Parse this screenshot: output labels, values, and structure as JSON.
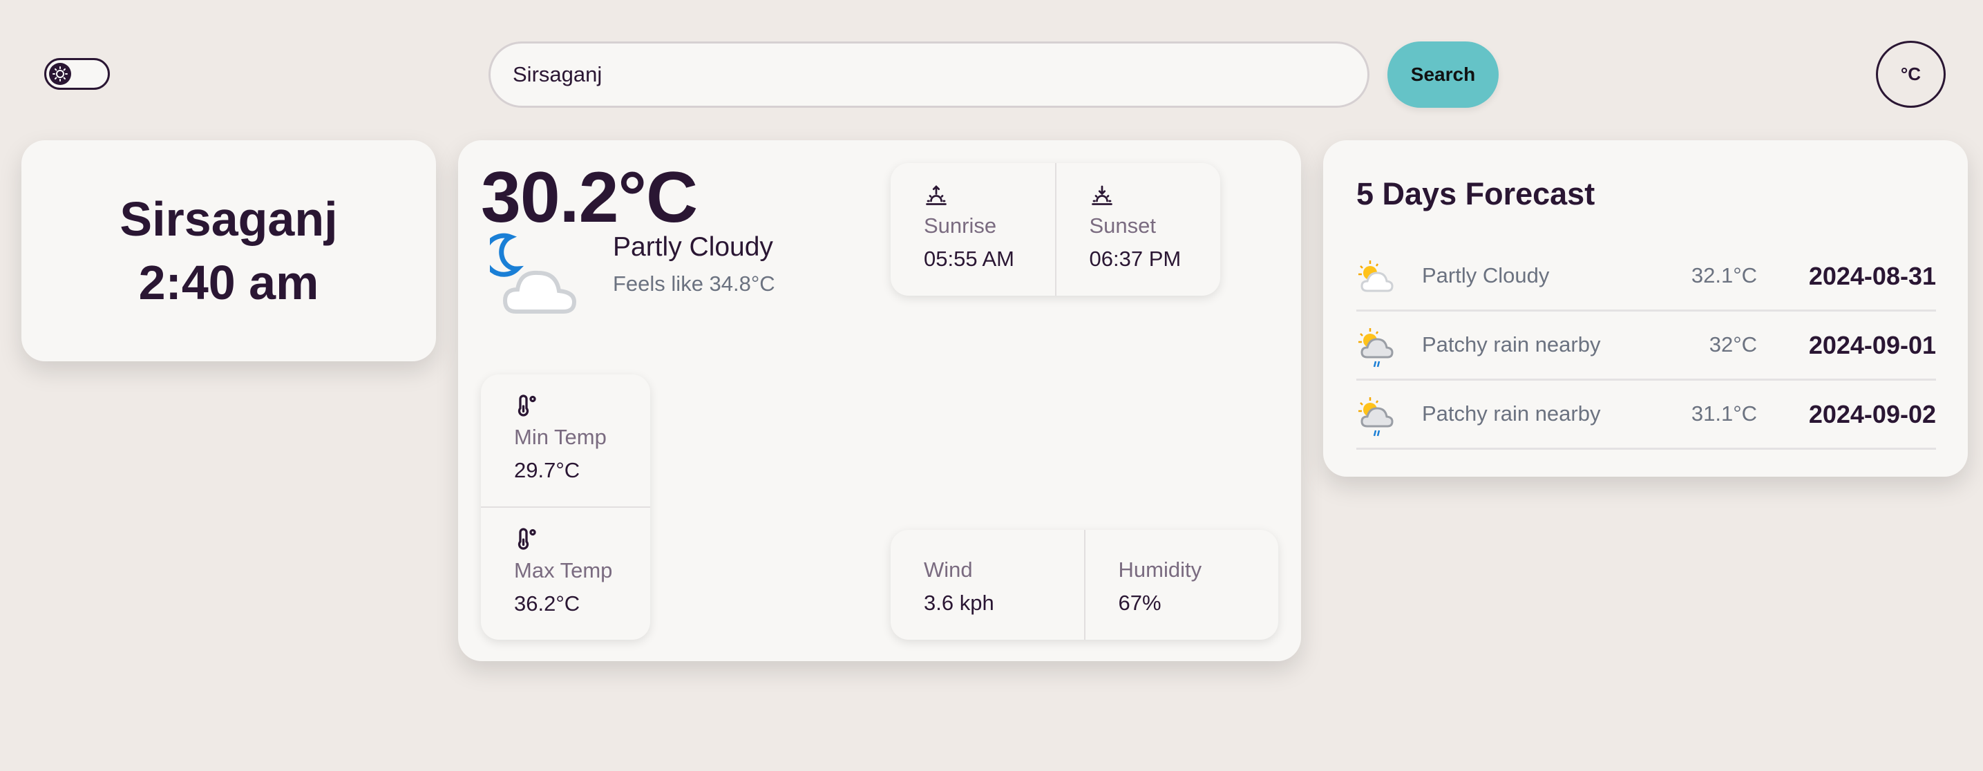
{
  "header": {
    "theme_toggle": {
      "icon": "sun-icon",
      "state": "light"
    },
    "search": {
      "value": "Sirsaganj",
      "button_label": "Search"
    },
    "unit_button_label": "°C"
  },
  "city_card": {
    "city": "Sirsaganj",
    "time": "2:40 am"
  },
  "current": {
    "temperature": "30.2°C",
    "condition": "Partly Cloudy",
    "feels_like": "Feels like 34.8°C",
    "icon": "moon-cloud-icon",
    "sunrise": {
      "label": "Sunrise",
      "value": "05:55 AM",
      "icon": "sunrise-icon"
    },
    "sunset": {
      "label": "Sunset",
      "value": "06:37 PM",
      "icon": "sunset-icon"
    },
    "min_temp": {
      "label": "Min Temp",
      "value": "29.7°C",
      "icon": "thermometer-icon"
    },
    "max_temp": {
      "label": "Max Temp",
      "value": "36.2°C",
      "icon": "thermometer-icon"
    },
    "wind": {
      "label": "Wind",
      "value": "3.6 kph"
    },
    "humidity": {
      "label": "Humidity",
      "value": "67%"
    }
  },
  "forecast": {
    "title": "5 Days Forecast",
    "days": [
      {
        "icon": "partly-cloudy-icon",
        "condition": "Partly Cloudy",
        "temp": "32.1°C",
        "date": "2024-08-31"
      },
      {
        "icon": "patchy-rain-icon",
        "condition": "Patchy rain nearby",
        "temp": "32°C",
        "date": "2024-09-01"
      },
      {
        "icon": "patchy-rain-icon",
        "condition": "Patchy rain nearby",
        "temp": "31.1°C",
        "date": "2024-09-02"
      }
    ]
  },
  "colors": {
    "background": "#efeae6",
    "card": "#f8f7f5",
    "text": "#2a1633",
    "accent": "#65c3c7",
    "muted": "#7a6b80"
  }
}
